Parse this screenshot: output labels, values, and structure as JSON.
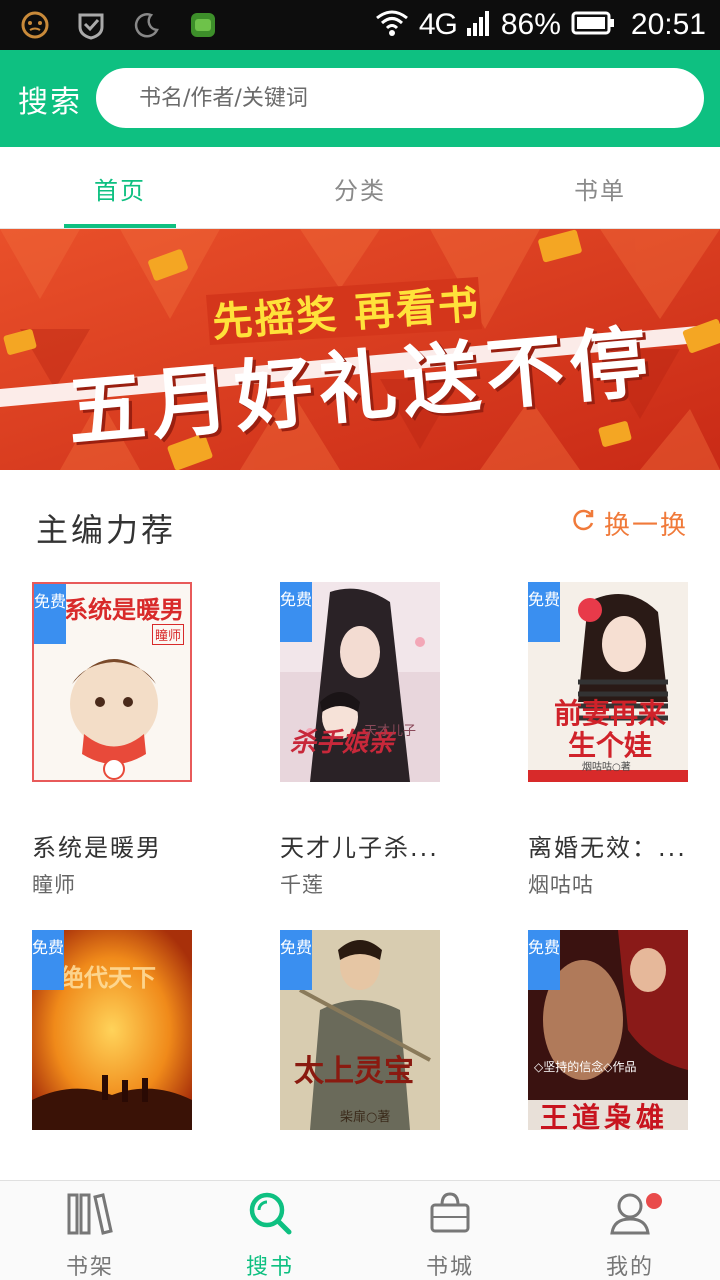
{
  "status_bar": {
    "network": "4G",
    "battery": "86%",
    "time": "20:51"
  },
  "search": {
    "label": "搜索",
    "placeholder": "书名/作者/关键词"
  },
  "tabs": [
    {
      "label": "首页",
      "active": true
    },
    {
      "label": "分类",
      "active": false
    },
    {
      "label": "书单",
      "active": false
    }
  ],
  "banner": {
    "tagline": "先摇奖 再看书",
    "headline": "五月好礼送不停"
  },
  "section": {
    "title": "主编力荐",
    "refresh_label": "换一换"
  },
  "books": [
    {
      "badge": "免费",
      "title": "系统是暖男",
      "author": "瞳师",
      "cover_title": "系统是暖男",
      "cover_author": "瞳师"
    },
    {
      "badge": "免费",
      "title": "天才儿子杀...",
      "author": "千莲",
      "cover_title": "杀手娘亲",
      "cover_subtitle": "天才儿子"
    },
    {
      "badge": "免费",
      "title": "离婚无效：...",
      "author": "烟咕咕",
      "cover_title": "前妻再来生个娃",
      "cover_author": "烟咕咕○著"
    },
    {
      "badge": "免费",
      "title": "",
      "author": "",
      "cover_title": "绝代天下"
    },
    {
      "badge": "免费",
      "title": "",
      "author": "",
      "cover_title": "太上灵宝",
      "cover_author": "柴扉○著"
    },
    {
      "badge": "免费",
      "title": "",
      "author": "",
      "cover_title": "王道枭雄",
      "cover_author": "◇坚持的信念◇作品"
    }
  ],
  "bottom_nav": [
    {
      "label": "书架",
      "icon": "bookshelf-icon",
      "active": false
    },
    {
      "label": "搜书",
      "icon": "search-icon",
      "active": true
    },
    {
      "label": "书城",
      "icon": "shopping-bag-icon",
      "active": false
    },
    {
      "label": "我的",
      "icon": "profile-icon",
      "active": false
    }
  ],
  "colors": {
    "primary": "#0ec081",
    "accent_orange": "#f07a3a",
    "badge_blue": "#3a8ff0",
    "notification_red": "#e94b4b"
  }
}
